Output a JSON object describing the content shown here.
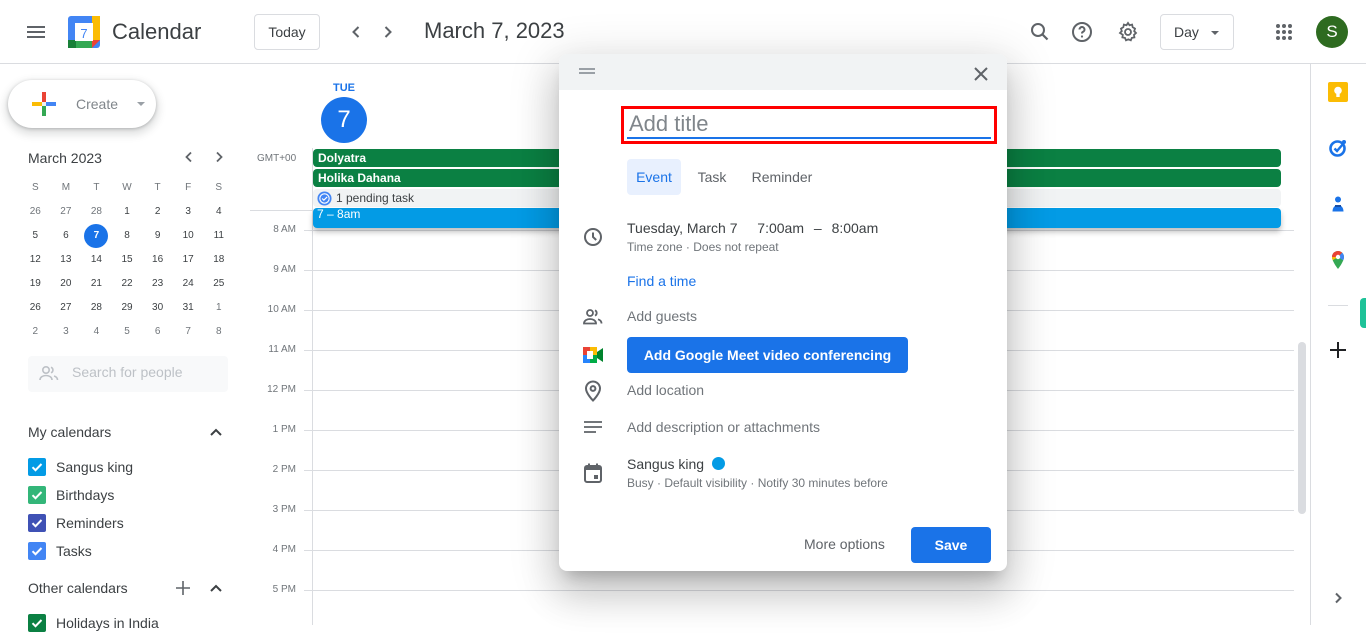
{
  "header": {
    "app_title": "Calendar",
    "logo_day": "7",
    "today_label": "Today",
    "date_title": "March 7, 2023",
    "view_selected": "Day",
    "avatar_initial": "S",
    "icons": [
      "menu-icon",
      "prev-icon",
      "next-icon",
      "search-icon",
      "help-icon",
      "settings-icon",
      "apps-icon"
    ]
  },
  "sidebar": {
    "create_label": "Create",
    "mini_calendar": {
      "month_label": "March 2023",
      "weekdays": [
        "S",
        "M",
        "T",
        "W",
        "T",
        "F",
        "S"
      ],
      "weeks": [
        [
          {
            "d": "26",
            "o": true
          },
          {
            "d": "27",
            "o": true
          },
          {
            "d": "28",
            "o": true
          },
          {
            "d": "1"
          },
          {
            "d": "2"
          },
          {
            "d": "3"
          },
          {
            "d": "4"
          }
        ],
        [
          {
            "d": "5"
          },
          {
            "d": "6"
          },
          {
            "d": "7",
            "sel": true
          },
          {
            "d": "8"
          },
          {
            "d": "9"
          },
          {
            "d": "10"
          },
          {
            "d": "11"
          }
        ],
        [
          {
            "d": "12"
          },
          {
            "d": "13"
          },
          {
            "d": "14"
          },
          {
            "d": "15"
          },
          {
            "d": "16"
          },
          {
            "d": "17"
          },
          {
            "d": "18"
          }
        ],
        [
          {
            "d": "19"
          },
          {
            "d": "20"
          },
          {
            "d": "21"
          },
          {
            "d": "22"
          },
          {
            "d": "23"
          },
          {
            "d": "24"
          },
          {
            "d": "25"
          }
        ],
        [
          {
            "d": "26"
          },
          {
            "d": "27"
          },
          {
            "d": "28"
          },
          {
            "d": "29"
          },
          {
            "d": "30"
          },
          {
            "d": "31"
          },
          {
            "d": "1",
            "o": true
          }
        ],
        [
          {
            "d": "2",
            "o": true
          },
          {
            "d": "3",
            "o": true
          },
          {
            "d": "4",
            "o": true
          },
          {
            "d": "5",
            "o": true
          },
          {
            "d": "6",
            "o": true
          },
          {
            "d": "7",
            "o": true
          },
          {
            "d": "8",
            "o": true
          }
        ]
      ]
    },
    "people_search_placeholder": "Search for people",
    "my_calendars_title": "My calendars",
    "my_calendars": [
      {
        "label": "Sangus king",
        "color": "#039be5",
        "checked": true
      },
      {
        "label": "Birthdays",
        "color": "#33b679",
        "checked": true
      },
      {
        "label": "Reminders",
        "color": "#3f51b5",
        "checked": true
      },
      {
        "label": "Tasks",
        "color": "#4285f4",
        "checked": true
      }
    ],
    "other_calendars_title": "Other calendars",
    "other_calendars": [
      {
        "label": "Holidays in India",
        "color": "#0b8043",
        "checked": true
      }
    ]
  },
  "day_view": {
    "dow": "TUE",
    "day_number": "7",
    "timezone_label": "GMT+00",
    "all_day_events": [
      {
        "title": "Dolyatra",
        "color": "#0b8043"
      },
      {
        "title": "Holika Dahana",
        "color": "#0b8043"
      }
    ],
    "pending_task": "1 pending task",
    "new_event_time": "7 – 8am",
    "new_event_color": "#039be5",
    "hours": [
      "8 AM",
      "9 AM",
      "10 AM",
      "11 AM",
      "12 PM",
      "1 PM",
      "2 PM",
      "3 PM",
      "4 PM",
      "5 PM"
    ]
  },
  "side_panel": {
    "icons": [
      "keep-icon",
      "tasks-icon",
      "contacts-icon",
      "maps-icon",
      "add-addon-icon",
      "expand-panel-icon"
    ]
  },
  "dialog": {
    "title_placeholder": "Add title",
    "title_value": "",
    "tabs": [
      {
        "label": "Event",
        "active": true
      },
      {
        "label": "Task",
        "active": false
      },
      {
        "label": "Reminder",
        "active": false
      }
    ],
    "date_line": "Tuesday, March 7",
    "start_time": "7:00am",
    "time_sep": "–",
    "end_time": "8:00am",
    "time_sub": "Time zone · Does not repeat",
    "find_time": "Find a time",
    "add_guests": "Add guests",
    "meet_button": "Add Google Meet video conferencing",
    "add_location": "Add location",
    "add_description": "Add description or attachments",
    "calendar_name": "Sangus king",
    "calendar_color": "#039be5",
    "calendar_sub": "Busy · Default visibility · Notify 30 minutes before",
    "more_options": "More options",
    "save": "Save"
  }
}
